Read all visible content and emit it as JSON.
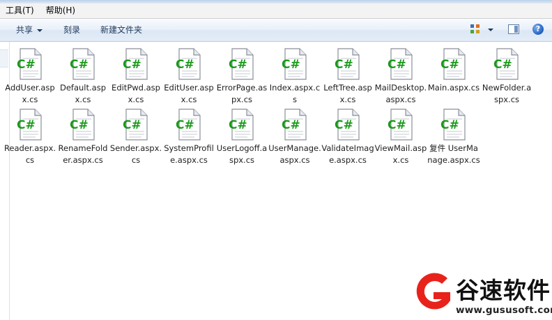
{
  "menubar": {
    "items": [
      {
        "label": "工具(T)"
      },
      {
        "label": "帮助(H)"
      }
    ]
  },
  "toolbar": {
    "share_label": "共享",
    "burn_label": "刻录",
    "new_folder_label": "新建文件夹",
    "help_glyph": "?"
  },
  "files": [
    {
      "name": "AddUser.aspx.cs"
    },
    {
      "name": "Default.aspx.cs"
    },
    {
      "name": "EditPwd.aspx.cs"
    },
    {
      "name": "EditUser.aspx.cs"
    },
    {
      "name": "ErrorPage.aspx.cs"
    },
    {
      "name": "Index.aspx.cs"
    },
    {
      "name": "LeftTree.aspx.cs"
    },
    {
      "name": "MailDesktop.aspx.cs"
    },
    {
      "name": "Main.aspx.cs"
    },
    {
      "name": "NewFolder.aspx.cs"
    },
    {
      "name": "Reader.aspx.cs"
    },
    {
      "name": "RenameFolder.aspx.cs"
    },
    {
      "name": "Sender.aspx.cs"
    },
    {
      "name": "SystemProfile.aspx.cs"
    },
    {
      "name": "UserLogoff.aspx.cs"
    },
    {
      "name": "UserManage.aspx.cs"
    },
    {
      "name": "ValidateImage.aspx.cs"
    },
    {
      "name": "ViewMail.aspx.cs"
    },
    {
      "name": "复件 UserManage.aspx.cs"
    }
  ],
  "file_icon": {
    "name": "csharp-file-icon",
    "glyph": "C#",
    "glyph_color": "#1a9a1a"
  },
  "watermark": {
    "name": "谷速软件",
    "url": "www.gususoft.com",
    "accent": "#e8221b"
  }
}
